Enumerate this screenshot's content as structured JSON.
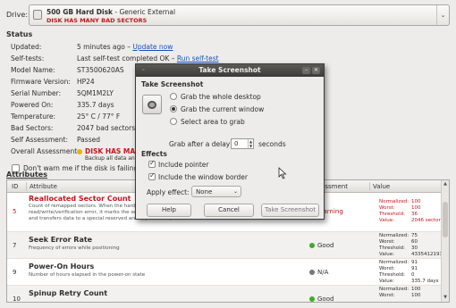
{
  "drive": {
    "label": "Drive:",
    "name": "500 GB Hard Disk",
    "desc": " - Generic External",
    "warning": "DISK HAS MANY BAD SECTORS"
  },
  "status": {
    "title": "Status",
    "rows": [
      {
        "key": "Updated:",
        "value": "5 minutes ago – ",
        "link": "Update now"
      },
      {
        "key": "Self-tests:",
        "value": "Last self-test completed OK – ",
        "link": "Run self-test"
      },
      {
        "key": "Model Name:",
        "value": "ST3500620AS"
      },
      {
        "key": "Firmware Version:",
        "value": "HP24"
      },
      {
        "key": "Serial Number:",
        "value": "5QM1M2LY"
      },
      {
        "key": "Powered On:",
        "value": "335.7 days"
      },
      {
        "key": "Temperature:",
        "value": "25° C / 77° F"
      },
      {
        "key": "Bad Sectors:",
        "value": "2047 bad sectors"
      },
      {
        "key": "Self Assessment:",
        "value": "Passed"
      }
    ],
    "overall_key": "Overall Assessment:",
    "overall_value": "DISK HAS MAN",
    "overall_sub": "Backup all data and",
    "warn_checkbox": "Don't warn me if the disk is failing"
  },
  "attributes": {
    "title": "Attributes",
    "columns": [
      "ID",
      "Attribute",
      "Assessment",
      "Value"
    ],
    "rows": [
      {
        "id": "5",
        "name": "Reallocated Sector Count",
        "desc": "Count of remapped sectors. When the hard drive finds a read/write/verification error, it marks the sector as \"reallocated\" and transfers data to a special reserved area (spare area)",
        "assessment": "Warning",
        "status": "warning",
        "normalized": "100",
        "worst": "100",
        "threshold": "36",
        "value": "2046 sectors"
      },
      {
        "id": "7",
        "name": "Seek Error Rate",
        "desc": "Frequency of errors while positioning",
        "assessment": "Good",
        "status": "good",
        "normalized": "75",
        "worst": "60",
        "threshold": "30",
        "value": "4335412193"
      },
      {
        "id": "9",
        "name": "Power-On Hours",
        "desc": "Number of hours elapsed in the power-on state",
        "assessment": "N/A",
        "status": "na",
        "normalized": "91",
        "worst": "91",
        "threshold": "0",
        "value": "335.7 days"
      },
      {
        "id": "10",
        "name": "Spinup Retry Count",
        "desc": "",
        "assessment": "Good",
        "status": "good",
        "normalized": "100",
        "worst": "100",
        "threshold": "",
        "value": ""
      }
    ],
    "value_labels": {
      "normalized": "Normalized:",
      "worst": "Worst:",
      "threshold": "Threshold:",
      "value": "Value:"
    }
  },
  "dialog": {
    "title": "Take Screenshot",
    "heading": "Take Screenshot",
    "options": [
      "Grab the whole desktop",
      "Grab the current window",
      "Select area to grab"
    ],
    "delay_label": "Grab after a delay of",
    "delay_value": "0",
    "delay_unit": "seconds",
    "effects_heading": "Effects",
    "include_pointer": "Include pointer",
    "include_border": "Include the window border",
    "apply_effect_label": "Apply effect:",
    "apply_effect_value": "None",
    "help": "Help",
    "cancel": "Cancel",
    "take": "Take Screenshot"
  },
  "colors": {
    "warning": "#c4161c",
    "good": "#3faa2f",
    "na": "#777777",
    "overall": "#e2b40e"
  }
}
